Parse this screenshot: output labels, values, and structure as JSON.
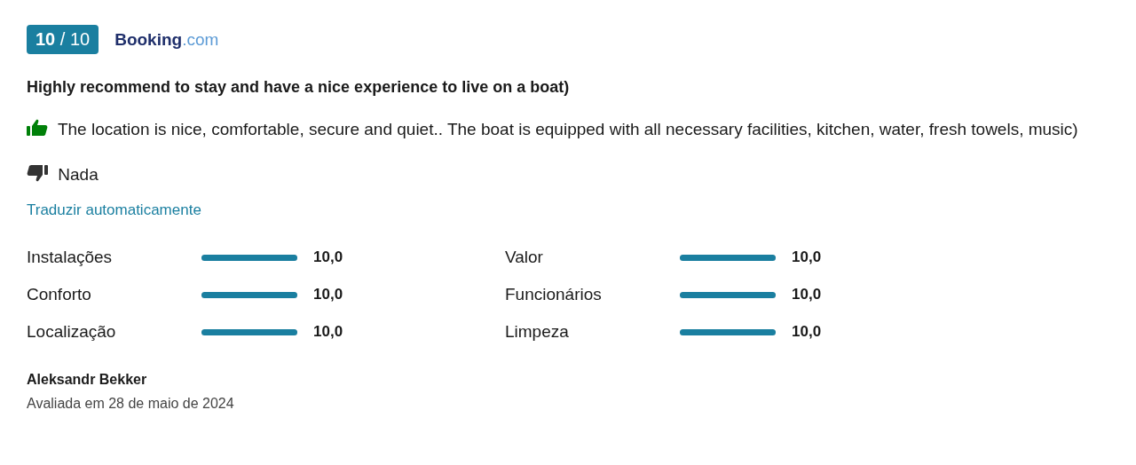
{
  "score_badge": "**10** / 10",
  "source_logo": {
    "name": "Booking",
    "suffix": ".com"
  },
  "title": "Highly recommend to stay and have a nice experience to live on a boat)",
  "positive": "The location is nice, comfortable, secure and quiet.. The boat is equipped with all necessary facilities, kitchen, water, fresh towels, music)",
  "negative": "Nada",
  "translate_link": "Traduzir automaticamente",
  "scores": [
    {
      "label": "Instalações",
      "level": 1,
      "value": "10,0"
    },
    {
      "label": "Conforto",
      "level": 1,
      "value": "10,0"
    },
    {
      "label": "Localização",
      "level": 1,
      "value": "10,0"
    },
    {
      "label": "Valor",
      "level": 1,
      "value": "10,0"
    },
    {
      "label": "Funcionários",
      "level": 1,
      "value": "10,0"
    },
    {
      "label": "Limpeza",
      "level": 1,
      "value": "10,0"
    }
  ],
  "reviewer": "Aleksandr Bekker",
  "review_date": "Avaliada em 28 de maio de 2024"
}
